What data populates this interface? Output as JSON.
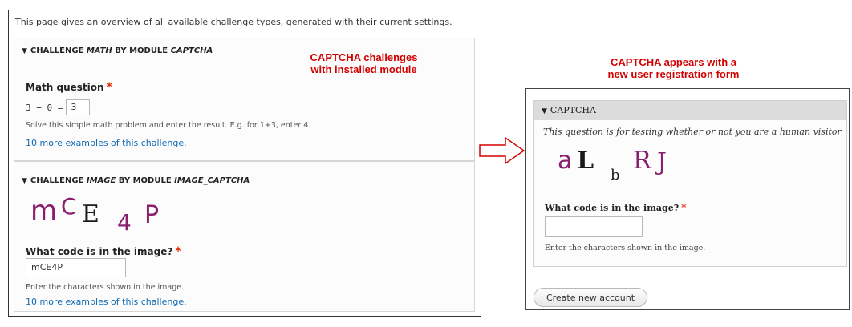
{
  "intro_text": "This page gives an overview of all available challenge types, generated with their current settings.",
  "math_challenge": {
    "summary_prefix": "Challenge",
    "summary_type": "Math",
    "summary_mid": "by module",
    "summary_module": "CAPTCHA",
    "label": "Math question",
    "required_mark": "*",
    "equation": "3 + 0 =",
    "answer_value": "3",
    "description": "Solve this simple math problem and enter the result. E.g. for 1+3, enter 4.",
    "more_examples_link": "10 more examples of this challenge."
  },
  "image_challenge": {
    "summary_prefix": "Challenge",
    "summary_type": "Image",
    "summary_mid": "by module",
    "summary_module": "Image_Captcha",
    "captcha_chars": [
      "m",
      "C",
      "E",
      "4",
      "P"
    ],
    "label": "What code is in the image?",
    "required_mark": "*",
    "input_value": "mCE4P",
    "description": "Enter the characters shown in the image.",
    "more_examples_link": "10 more examples of this challenge."
  },
  "annotations": {
    "left_line1": "CAPTCHA challenges",
    "left_line2": "with installed module",
    "right_line1": "CAPTCHA appears with a",
    "right_line2": "new user registration form"
  },
  "registration": {
    "fieldset_title": "CAPTCHA",
    "description": "This question is for testing whether or not you are a human visitor",
    "captcha_chars": [
      "a",
      "L",
      "b",
      "R",
      "J"
    ],
    "label": "What code is in the image?",
    "required_mark": "*",
    "input_value": "",
    "help_text": "Enter the characters shown in the image.",
    "submit_label": "Create new account"
  },
  "colors": {
    "annotation_red": "#d40000",
    "link_blue": "#0f6ab4",
    "required_red": "#e32700"
  }
}
